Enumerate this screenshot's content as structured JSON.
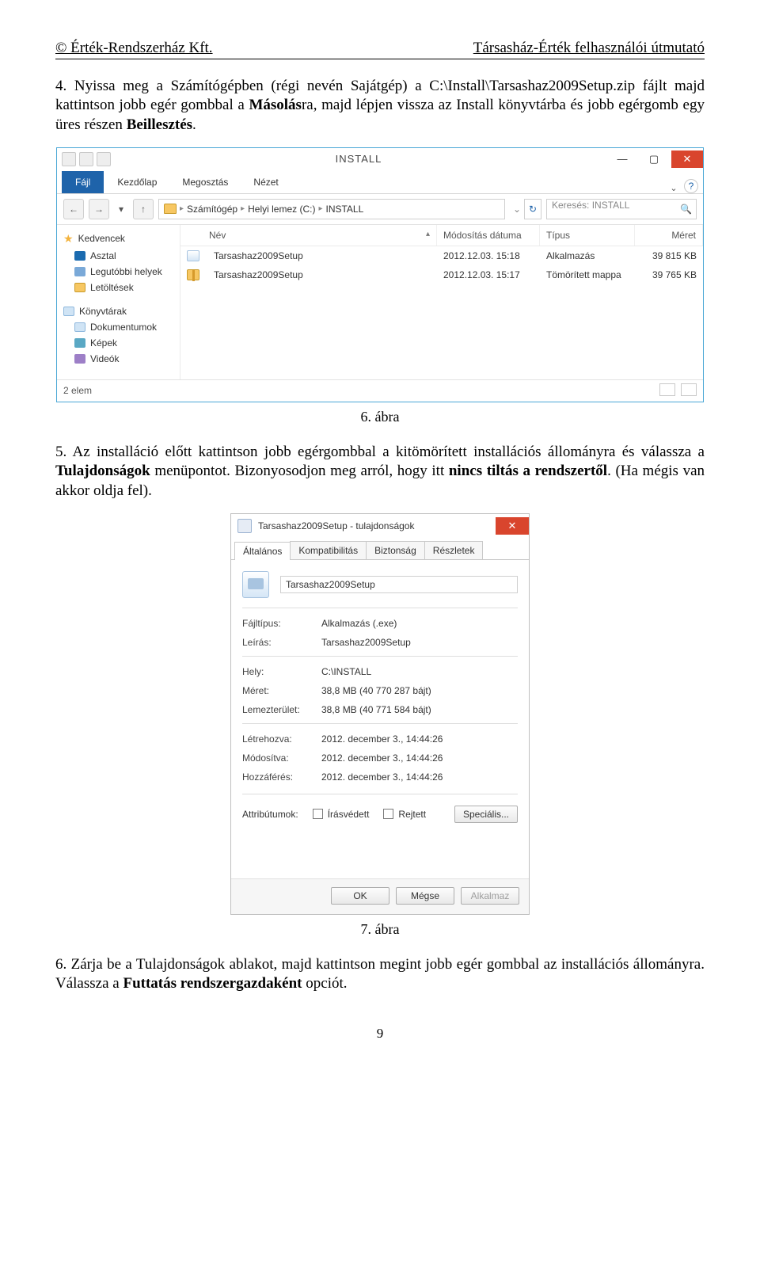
{
  "header": {
    "left": "© Érték-Rendszerház Kft.",
    "right": "Társasház-Érték felhasználói útmutató"
  },
  "para4_a": "4. Nyissa meg a Számítógépben (régi nevén Sajátgép) a C:\\Install\\Tarsashaz2009Setup.zip fájlt majd kattintson jobb egér gombbal a ",
  "para4_b": "Másolás",
  "para4_c": "ra, majd lépjen vissza az Install könyvtárba és jobb egérgomb egy üres részen ",
  "para4_d": "Beillesztés",
  "para4_e": ".",
  "fig6": "6. ábra",
  "para5_a": "5. Az installáció előtt kattintson jobb egérgombbal a kitömörített installációs állományra és válassza a ",
  "para5_b": "Tulajdonságok",
  "para5_c": " menüpontot. Bizonyosodjon meg arról, hogy itt ",
  "para5_d": "nincs tiltás a rendszertől",
  "para5_e": ". (Ha mégis van akkor oldja fel).",
  "fig7": "7. ábra",
  "para6_a": "6. Zárja be a Tulajdonságok ablakot, majd kattintson megint jobb egér gombbal az installációs állományra. Válassza a ",
  "para6_b": "Futtatás rendszergazdaként",
  "para6_c": " opciót.",
  "pagenum": "9",
  "explorer": {
    "title": "INSTALL",
    "tabs": {
      "file": "Fájl",
      "home": "Kezdőlap",
      "share": "Megosztás",
      "view": "Nézet"
    },
    "crumbs": [
      "Számítógép",
      "Helyi lemez (C:)",
      "INSTALL"
    ],
    "searchPlaceholder": "Keresés: INSTALL",
    "columns": {
      "name": "Név",
      "date": "Módosítás dátuma",
      "type": "Típus",
      "size": "Méret"
    },
    "rows": [
      {
        "name": "Tarsashaz2009Setup",
        "date": "2012.12.03. 15:18",
        "type": "Alkalmazás",
        "size": "39 815 KB",
        "kind": "exe"
      },
      {
        "name": "Tarsashaz2009Setup",
        "date": "2012.12.03. 15:17",
        "type": "Tömörített mappa",
        "size": "39 765 KB",
        "kind": "zip"
      }
    ],
    "nav": {
      "fav": "Kedvencek",
      "desk": "Asztal",
      "recent": "Legutóbbi helyek",
      "dl": "Letöltések",
      "lib": "Könyvtárak",
      "docs": "Dokumentumok",
      "pics": "Képek",
      "vids": "Videók"
    },
    "status": "2 elem"
  },
  "props": {
    "title": "Tarsashaz2009Setup - tulajdonságok",
    "tabs": {
      "general": "Általános",
      "compat": "Kompatibilitás",
      "security": "Biztonság",
      "details": "Részletek"
    },
    "filename": "Tarsashaz2009Setup",
    "labels": {
      "filetype": "Fájltípus:",
      "desc": "Leírás:",
      "loc": "Hely:",
      "size": "Méret:",
      "disk": "Lemezterület:",
      "created": "Létrehozva:",
      "modified": "Módosítva:",
      "accessed": "Hozzáférés:",
      "attrs": "Attribútumok:",
      "ro": "Írásvédett",
      "hidden": "Rejtett",
      "advanced": "Speciális..."
    },
    "values": {
      "filetype": "Alkalmazás (.exe)",
      "desc": "Tarsashaz2009Setup",
      "loc": "C:\\INSTALL",
      "size": "38,8 MB (40 770 287 bájt)",
      "disk": "38,8 MB (40 771 584 bájt)",
      "created": "2012. december 3., 14:44:26",
      "modified": "2012. december 3., 14:44:26",
      "accessed": "2012. december 3., 14:44:26"
    },
    "buttons": {
      "ok": "OK",
      "cancel": "Mégse",
      "apply": "Alkalmaz"
    }
  }
}
